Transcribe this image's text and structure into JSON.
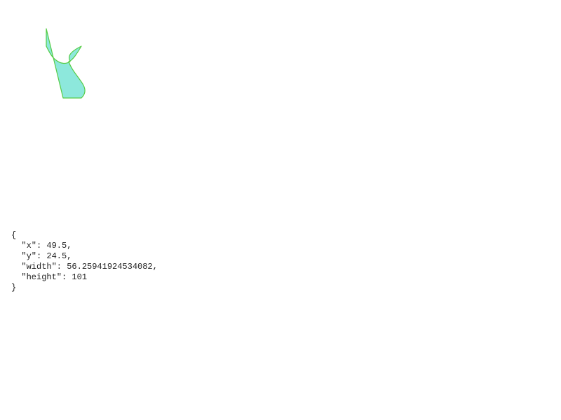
{
  "shape": {
    "fill_color": "#8de8dc",
    "stroke_color": "#55cc44"
  },
  "readout": {
    "open_brace": "{",
    "line_x": "  \"x\": 49.5,",
    "line_y": "  \"y\": 24.5,",
    "line_width": "  \"width\": 56.25941924534082,",
    "line_height": "  \"height\": 101",
    "close_brace": "}"
  }
}
